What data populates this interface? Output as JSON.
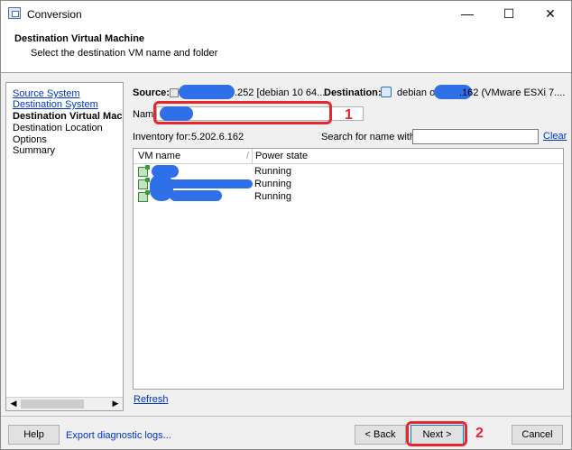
{
  "window": {
    "title": "Conversion",
    "minimize_glyph": "—",
    "maximize_glyph": "☐",
    "close_glyph": "✕"
  },
  "header": {
    "title": "Destination Virtual Machine",
    "subtitle": "Select the destination VM name and folder"
  },
  "nav": {
    "items": [
      {
        "label": "Source System",
        "state": "link"
      },
      {
        "label": "Destination System",
        "state": "link"
      },
      {
        "label": "Destination Virtual Machine",
        "state": "current"
      },
      {
        "label": "Destination Location",
        "state": "normal"
      },
      {
        "label": "Options",
        "state": "normal"
      },
      {
        "label": "Summary",
        "state": "normal"
      }
    ]
  },
  "source": {
    "label": "Source:",
    "value": ".252 [debian 10 64..."
  },
  "destination": {
    "label": "Destination:",
    "value_prefix": "debian on",
    "value_suffix": ".162 (VMware ESXi 7...."
  },
  "name_field": {
    "label": "Name:",
    "value": ""
  },
  "inventory": {
    "label": "Inventory for:",
    "value": "5.202.6.162"
  },
  "search": {
    "label": "Search for name with:",
    "value": "",
    "clear_label": "Clear"
  },
  "table": {
    "columns": [
      "VM name",
      "Power state"
    ],
    "rows": [
      {
        "vm_name": "",
        "power_state": "Running"
      },
      {
        "vm_name": "",
        "power_state": "Running"
      },
      {
        "vm_name": "",
        "power_state": "Running"
      }
    ]
  },
  "refresh_label": "Refresh",
  "footer": {
    "help_label": "Help",
    "export_label": "Export diagnostic logs...",
    "back_label": "< Back",
    "next_label": "Next >",
    "cancel_label": "Cancel"
  },
  "annotations": {
    "marker_1": "1",
    "marker_2": "2",
    "color": "#e8262d"
  },
  "redaction_color": "#2f6fe8"
}
